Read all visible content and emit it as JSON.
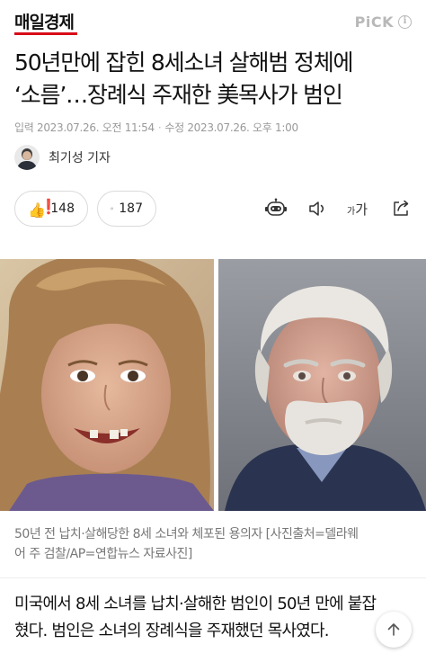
{
  "header": {
    "logo": "매일경제",
    "pick": "PiCK",
    "info_glyph": "i"
  },
  "article": {
    "headline_line1": "50년만에 잡힌 8세소녀 살해범 정체에",
    "headline_line2": "‘소름’…장례식 주재한 美목사가 범인",
    "published": "입력 2023.07.26. 오전 11:54",
    "updated": "수정 2023.07.26. 오후 1:00",
    "reporter": "최기성 기자"
  },
  "actions": {
    "reaction_count": "148",
    "comment_count": "187",
    "font_label_small": "가",
    "font_label_large": "가",
    "icons": [
      "thumbs-up-icon",
      "comment-icon",
      "robot-summary-icon",
      "speaker-icon",
      "font-size-icon",
      "share-icon"
    ]
  },
  "photo": {
    "caption_line1": "50년 전 납치·살해당한 8세 소녀와 체포된 용의자 [사진출처=델라웨",
    "caption_line2": "어 주 검찰/AP=연합뉴스 자료사진]"
  },
  "body": {
    "line1": "미국에서 8세 소녀를 납치·살해한 범인이 50년 만에 붙잡",
    "line2": "혔다. 범인은 소녀의 장례식을 주재했던 목사였다."
  },
  "colors": {
    "brand_red": "#d80c18",
    "muted_text": "#999999",
    "caption_text": "#777777",
    "border": "#dadada"
  }
}
